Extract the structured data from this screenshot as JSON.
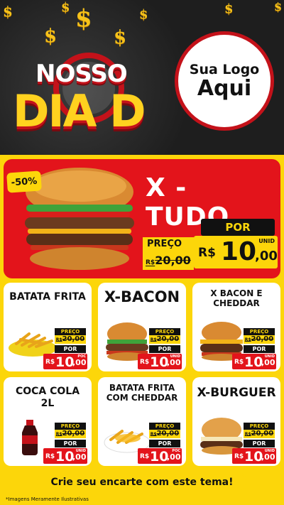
{
  "header": {
    "title_line1": "NOSSO",
    "title_line2": "DIA D",
    "logo_line1": "Sua Logo",
    "logo_line2": "Aqui"
  },
  "hero": {
    "discount": "-50%",
    "name": "X - TUDO",
    "preco_label": "PREÇO",
    "old_currency": "R$",
    "old_price": "20,00",
    "por_label": "POR",
    "currency": "R$",
    "price_int": "10",
    "price_dec": ",00",
    "unit": "UNID"
  },
  "products": [
    {
      "name": "BATATA FRITA",
      "preco_label": "PREÇO",
      "old_currency": "R$",
      "old_price": "20,00",
      "por_label": "POR",
      "currency": "R$",
      "price_int": "10",
      "price_dec": ",00",
      "unit": "POC"
    },
    {
      "name": "X-BACON",
      "preco_label": "PREÇO",
      "old_currency": "R$",
      "old_price": "20,00",
      "por_label": "POR",
      "currency": "R$",
      "price_int": "10",
      "price_dec": ",00",
      "unit": "UNID"
    },
    {
      "name": "X BACON E CHEDDAR",
      "preco_label": "PREÇO",
      "old_currency": "R$",
      "old_price": "20,00",
      "por_label": "POR",
      "currency": "R$",
      "price_int": "10",
      "price_dec": ",00",
      "unit": "UNID"
    },
    {
      "name": "COCA COLA 2L",
      "preco_label": "PREÇO",
      "old_currency": "R$",
      "old_price": "20,00",
      "por_label": "POR",
      "currency": "R$",
      "price_int": "10",
      "price_dec": ",00",
      "unit": "UNID"
    },
    {
      "name": "BATATA FRITA COM CHEDDAR",
      "preco_label": "PREÇO",
      "old_currency": "R$",
      "old_price": "20,00",
      "por_label": "POR",
      "currency": "R$",
      "price_int": "10",
      "price_dec": ",00",
      "unit": "POC"
    },
    {
      "name": "X-BURGUER",
      "preco_label": "PREÇO",
      "old_currency": "R$",
      "old_price": "20,00",
      "por_label": "POR",
      "currency": "R$",
      "price_int": "10",
      "price_dec": ",00",
      "unit": "UNID"
    }
  ],
  "footer": {
    "cta": "Crie seu encarte com este tema!",
    "disclaimer": "*Imagens Meramente Ilustrativas"
  },
  "colors": {
    "yellow": "#fcd60a",
    "red": "#e3141b",
    "dark": "#1e1e1e"
  }
}
